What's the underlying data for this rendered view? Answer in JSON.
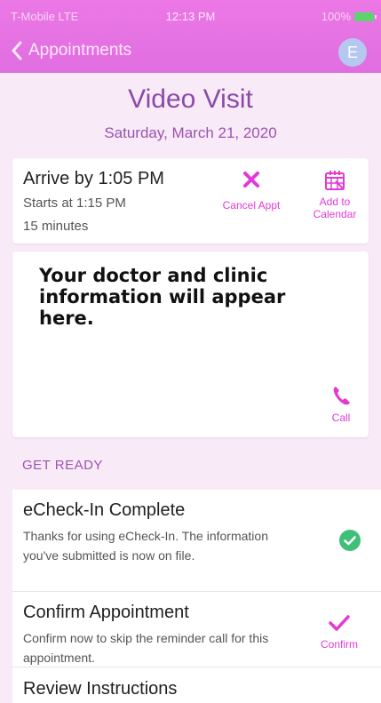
{
  "status_bar": {
    "carrier": "T-Mobile LTE",
    "time": "12:13 PM",
    "battery": "100%"
  },
  "nav": {
    "back_label": "Appointments",
    "avatar_initial": "E"
  },
  "visit": {
    "title": "Video Visit",
    "date": "Saturday, March 21, 2020"
  },
  "appointment": {
    "arrive": "Arrive by 1:05 PM",
    "starts": "Starts at 1:15 PM",
    "duration": "15 minutes",
    "cancel_label": "Cancel Appt",
    "calendar_label_1": "Add to",
    "calendar_label_2": "Calendar"
  },
  "doctor": {
    "placeholder": "Your doctor and clinic information will appear here.",
    "call_label": "Call"
  },
  "get_ready": {
    "section_label": "GET READY",
    "items": [
      {
        "title": "eCheck-In Complete",
        "description": "Thanks for using eCheck-In. The information you've submitted is now on file."
      },
      {
        "title": "Confirm Appointment",
        "description": "Confirm now to skip the reminder call for this appointment.",
        "action_label": "Confirm"
      },
      {
        "title": "Review Instructions"
      }
    ]
  },
  "colors": {
    "accent": "#e33ad6",
    "header": "#ec78e6",
    "title": "#8a4aa8",
    "success": "#3fbf77"
  },
  "icons": {
    "back": "chevron-left-icon",
    "cancel": "close-icon",
    "calendar": "calendar-icon",
    "call": "phone-icon",
    "complete": "check-circle-icon",
    "confirm": "check-icon"
  }
}
